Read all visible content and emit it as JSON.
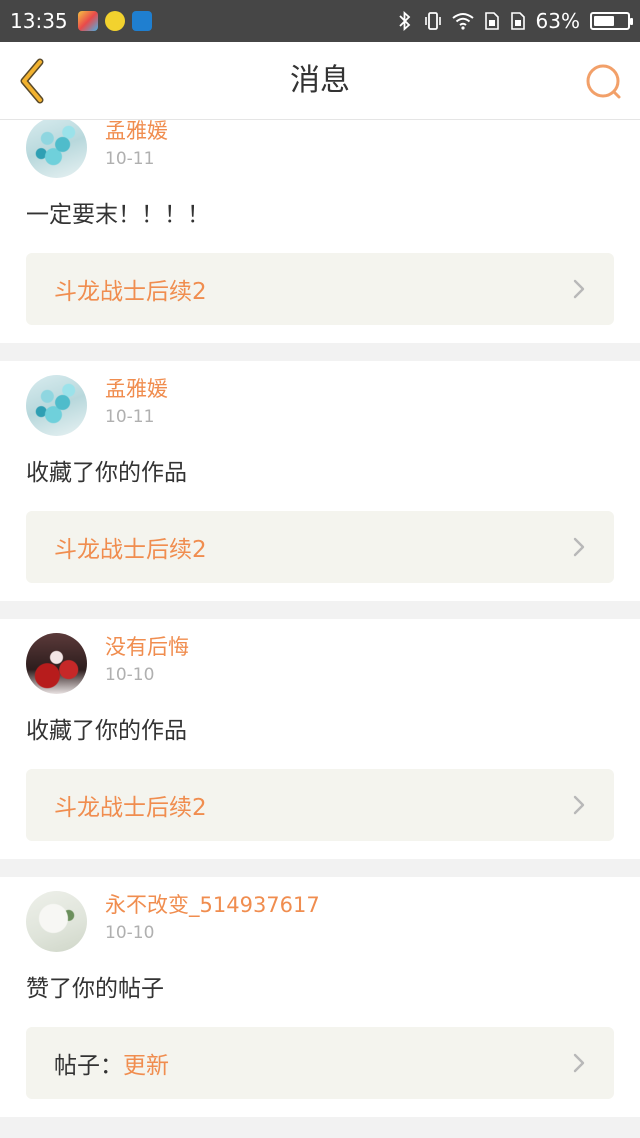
{
  "status_bar": {
    "time": "13:35",
    "battery_percent": "63%",
    "battery_level": 0.63,
    "icons": [
      "app-icon-1",
      "app-icon-2",
      "app-icon-3",
      "bluetooth-icon",
      "vibrate-icon",
      "wifi-icon",
      "sim1-icon",
      "sim2-icon",
      "battery-icon"
    ]
  },
  "nav": {
    "title": "消息",
    "back_icon": "back-chevron-icon",
    "search_icon": "search-icon"
  },
  "colors": {
    "accent": "#f08d4f",
    "back_arrow": "#f2b22f",
    "card_link_bg": "#f4f4ee",
    "page_bg": "#f2f2f2"
  },
  "messages": [
    {
      "username": "孟雅媛",
      "date": "10-11",
      "text": "一定要末！！！！",
      "link_prefix": "",
      "link_title": "斗龙战士后续2",
      "avatar": "flowers"
    },
    {
      "username": "孟雅媛",
      "date": "10-11",
      "text": "收藏了你的作品",
      "link_prefix": "",
      "link_title": "斗龙战士后续2",
      "avatar": "flowers"
    },
    {
      "username": "没有后悔",
      "date": "10-10",
      "text": "收藏了你的作品",
      "link_prefix": "",
      "link_title": "斗龙战士后续2",
      "avatar": "dark"
    },
    {
      "username": "永不改变_514937617",
      "date": "10-10",
      "text": "赞了你的帖子",
      "link_prefix": "帖子：",
      "link_title": "更新",
      "avatar": "pale"
    }
  ]
}
